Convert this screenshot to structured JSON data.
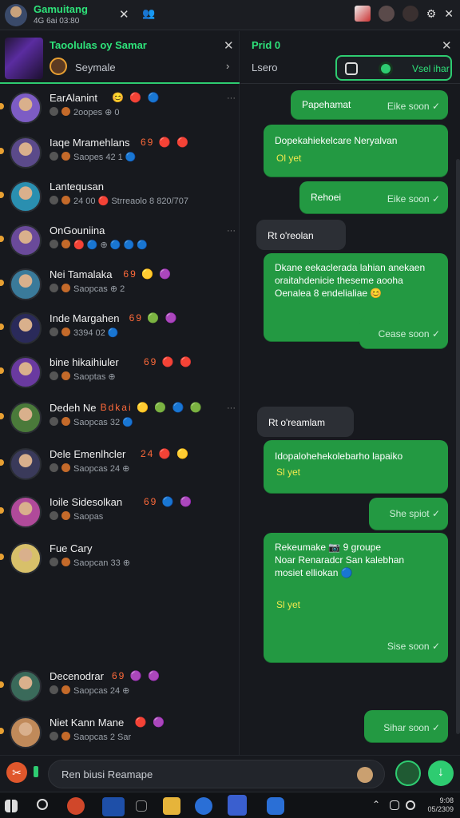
{
  "window": {
    "title": "Gamuitang",
    "subtitle": "4G 6ai 03:80",
    "close": "✕"
  },
  "left_header": {
    "title": "Taoolulas oy Samar",
    "subtitle": "Seymale",
    "close": "✕",
    "arrow": "›"
  },
  "right_header": {
    "title": "Prid 0",
    "subtitle": "Lsero",
    "close": "✕",
    "control_label": "Vsel ihar"
  },
  "conversations": [
    {
      "name": "EarAlanint",
      "emoji": "😊 🔴 🔵",
      "line": "2oopes ⊕ 0",
      "avatar": "#7d5cc4"
    },
    {
      "name": "Iaqe Mramehlans",
      "emoji": "69 🔴 🔴",
      "line": "Saopes 42 1 🔵",
      "avatar": "#5b4a8a"
    },
    {
      "name": "Lantequsan",
      "emoji": "",
      "line": "24 00 🔴 Strreaolo 8 820/707",
      "avatar": "#2a8fb0"
    },
    {
      "name": "OnGouniina",
      "emoji": "",
      "line": "🔴 🔵 ⊕ 🔵 🔵 🔵",
      "avatar": "#6a4a9a"
    },
    {
      "name": "Nei Tamalaka",
      "emoji": "69 🟡 🟣",
      "line": "Saopcas ⊕ 2",
      "avatar": "#3a7a9a"
    },
    {
      "name": "Inde Margahen",
      "emoji": "69 🟢 🟣",
      "line": "3394 02 🔵",
      "avatar": "#2a2a5a"
    },
    {
      "name": "bine hikaihiuler",
      "emoji": "69 🔴 🔴",
      "line": "Saoptas ⊕",
      "avatar": "#6a3aa0"
    },
    {
      "name": "Dedeh Ne",
      "emoji": "Bdkai 🟡 🟢 🔵 🟢",
      "line": "Saopcas 32 🔵",
      "avatar": "#4a7a3a"
    },
    {
      "name": "Dele Emenlhcler",
      "emoji": "24 🔴 🟡",
      "line": "Saopcas 24 ⊕",
      "avatar": "#3a3a5a"
    },
    {
      "name": "Ioile Sidesolkan",
      "emoji": "69 🔵 🟣",
      "line": "Saopas",
      "avatar": "#b04a9a"
    },
    {
      "name": "Fue Cary",
      "emoji": "",
      "line": "Saopcan 33 ⊕",
      "avatar": "#d8c06a"
    },
    {
      "name": "Decenodrar",
      "emoji": "69 🟣 🟣",
      "line": "Saopcas 24 ⊕",
      "avatar": "#3a6a5a"
    },
    {
      "name": "Niet Kann Mane",
      "emoji": "🔴 🟣",
      "line": "Saopcas 2 Sar",
      "avatar": "#c08a5a"
    }
  ],
  "messages": [
    {
      "dir": "out",
      "text": "Papehamat",
      "time": "Eike soon ✓"
    },
    {
      "dir": "out",
      "text": "Dopekahiekelcare Neryalvan",
      "tag": "Ol yet",
      "time": ""
    },
    {
      "dir": "out",
      "text": "Rehoei",
      "time": "Eike soon ✓"
    },
    {
      "dir": "in",
      "text": "Rt o'reolan",
      "time": ""
    },
    {
      "dir": "out",
      "text": "Dkane eekaclerada lahian anekaen\noraitahdenicie theseme aooha\nOenalea 8 endelialiae 😊",
      "time": ""
    },
    {
      "dir": "out",
      "text": "",
      "time": "Cease soon ✓"
    },
    {
      "dir": "in",
      "text": "Rt o'reamlam",
      "time": ""
    },
    {
      "dir": "out",
      "text": "Idopalohehekolebarho lapaiko",
      "tag": "Sl yet",
      "time": ""
    },
    {
      "dir": "out",
      "text": "",
      "time": "She spiot ✓"
    },
    {
      "dir": "out",
      "text": "Rekeumake 📷 9 groupe\nNoar Renaradcr San kalebhan\nmosiet elliokan 🔵",
      "tag": "Sl yet",
      "time": "Sise soon ✓"
    },
    {
      "dir": "out",
      "text": "",
      "time": "Sihar soon ✓"
    }
  ],
  "composer": {
    "placeholder": "Ren biusi Reamape"
  },
  "taskbar": {
    "clock_line1": "9:08",
    "clock_line2": "05/2309"
  },
  "colors": {
    "accent": "#2ecc71",
    "bubble_out": "#239942",
    "bubble_in": "#2c2f35",
    "background": "#17191e"
  }
}
